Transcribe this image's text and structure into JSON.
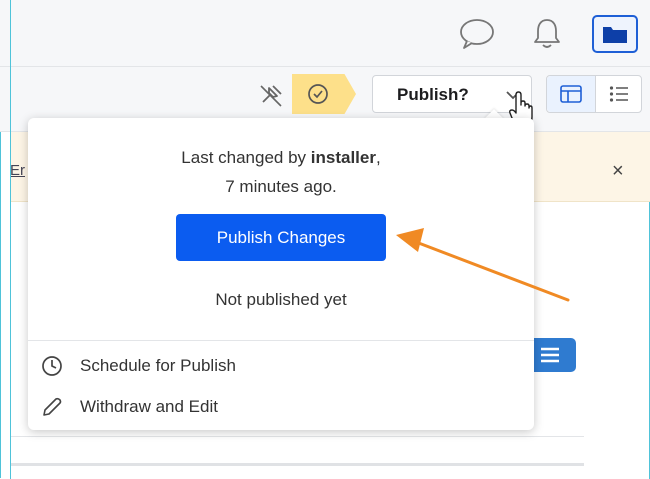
{
  "topbar": {
    "icons": [
      "comment-icon",
      "bell-icon",
      "folder-icon"
    ]
  },
  "toolbar": {
    "publish_label": "Publish?",
    "status_badge_icon": "check-circle-icon",
    "unpin_icon": "pin-off-icon",
    "view_icons": [
      "layout-icon",
      "list-icon"
    ]
  },
  "notice": {
    "partial_text": "Er",
    "close_label": "×"
  },
  "popover": {
    "changed_prefix": "Last changed by ",
    "changed_user": "installer",
    "changed_suffix": ",",
    "changed_time": "7 minutes ago.",
    "publish_changes_label": "Publish Changes",
    "status_text": "Not published yet",
    "menu": [
      {
        "label": "Schedule for Publish",
        "icon": "clock-icon"
      },
      {
        "label": "Withdraw and Edit",
        "icon": "pencil-icon"
      }
    ]
  },
  "colors": {
    "primary": "#0b5cf0",
    "badge": "#fde08a",
    "annotation_arrow": "#f08a24",
    "frame": "#4fc3d9"
  }
}
